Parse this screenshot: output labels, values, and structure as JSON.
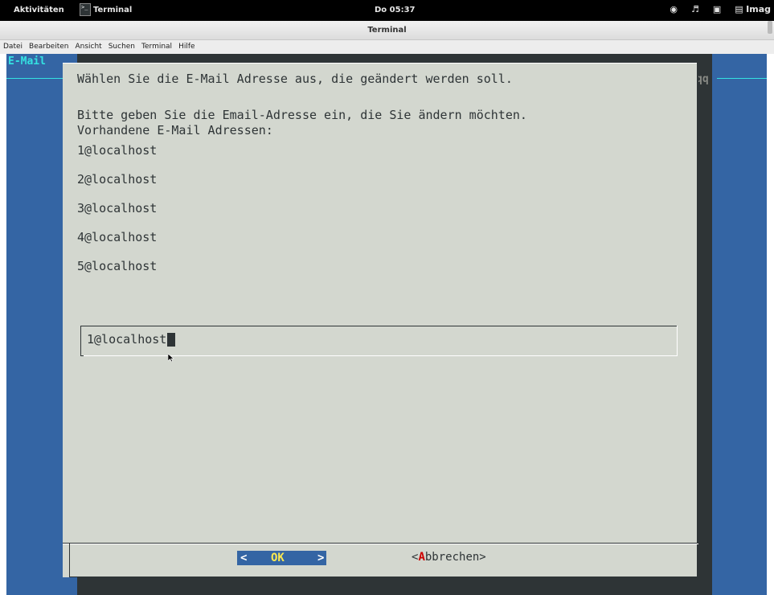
{
  "topbar": {
    "activities": "Aktivitäten",
    "app_name": "Terminal",
    "clock": "Do 05:37",
    "tray_user": "Imag"
  },
  "window": {
    "title": "Terminal"
  },
  "menu": [
    "Datei",
    "Bearbeiten",
    "Ansicht",
    "Suchen",
    "Terminal",
    "Hilfe"
  ],
  "terminal": {
    "header": "E-Mail",
    "right_fragment": "qq",
    "colors": {
      "background": "#3465a4",
      "header": "#34e2e2",
      "dialog": "#d3d7cf"
    }
  },
  "dialog": {
    "title": "Wählen Sie die E-Mail Adresse aus, die geändert werden soll.",
    "prompt_line1": "Bitte geben Sie die Email-Adresse ein, die Sie ändern möchten.",
    "prompt_line2": "Vorhandene E-Mail Adressen:",
    "addresses": [
      "1@localhost",
      "2@localhost",
      "3@localhost",
      "4@localhost",
      "5@localhost"
    ],
    "input_value": "1@localhost",
    "ok_lt": "<",
    "ok_label": "OK",
    "ok_gt": ">",
    "cancel_prefix": "<",
    "cancel_hotkey": "A",
    "cancel_rest": "bbrechen>"
  }
}
